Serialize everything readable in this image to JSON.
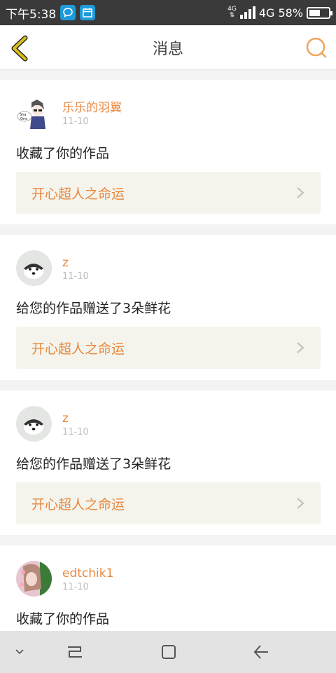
{
  "status_bar": {
    "time": "下午5:38",
    "network_small": "4G",
    "network": "4G",
    "battery": "58%",
    "battery_level": 0.58
  },
  "header": {
    "title": "消息"
  },
  "messages": [
    {
      "username": "乐乐的羽翼",
      "date": "11-10",
      "action": "收藏了你的作品",
      "work_title": "开心超人之命运"
    },
    {
      "username": "z",
      "date": "11-10",
      "action": "给您的作品赠送了3朵鲜花",
      "work_title": "开心超人之命运"
    },
    {
      "username": "z",
      "date": "11-10",
      "action": "给您的作品赠送了3朵鲜花",
      "work_title": "开心超人之命运"
    },
    {
      "username": "edtchik1",
      "date": "11-10",
      "action": "收藏了你的作品",
      "work_title": ""
    }
  ],
  "colors": {
    "accent": "#e8883f",
    "back_arrow": "#d4b800",
    "card_link_bg": "#f4f4ec"
  }
}
